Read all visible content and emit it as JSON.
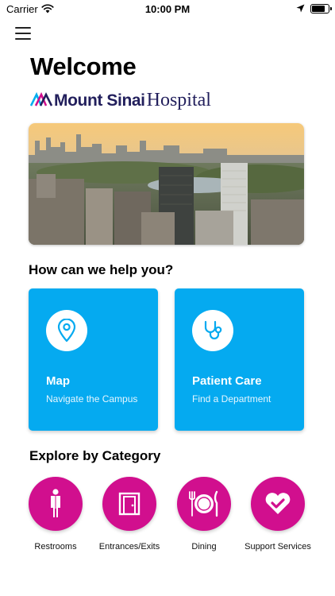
{
  "status_bar": {
    "carrier": "Carrier",
    "time": "10:00 PM",
    "battery_level": 0.9
  },
  "header": {
    "menu_icon": "hamburger-icon",
    "welcome": "Welcome"
  },
  "brand": {
    "name_bold": "Mount Sinai",
    "name_regular": "Hospital",
    "colors": {
      "navy": "#221f5c",
      "magenta": "#d10f8e",
      "cyan": "#00aeef"
    }
  },
  "hero": {
    "image": "aerial photo of hospital campus and city skyline"
  },
  "help": {
    "title": "How can we help you?",
    "cards": [
      {
        "title": "Map",
        "subtitle": "Navigate the Campus",
        "icon": "map-pin-icon"
      },
      {
        "title": "Patient Care",
        "subtitle": "Find a Department",
        "icon": "stethoscope-icon"
      }
    ]
  },
  "explore": {
    "title": "Explore by Category",
    "categories": [
      {
        "label": "Restrooms",
        "icon": "restroom-icon"
      },
      {
        "label": "Entrances/Exits",
        "icon": "door-icon"
      },
      {
        "label": "Dining",
        "icon": "dining-icon"
      },
      {
        "label": "Support Services",
        "icon": "heart-icon"
      }
    ]
  },
  "colors": {
    "card_blue": "#05aaf0",
    "category_magenta": "#d10f8e"
  }
}
